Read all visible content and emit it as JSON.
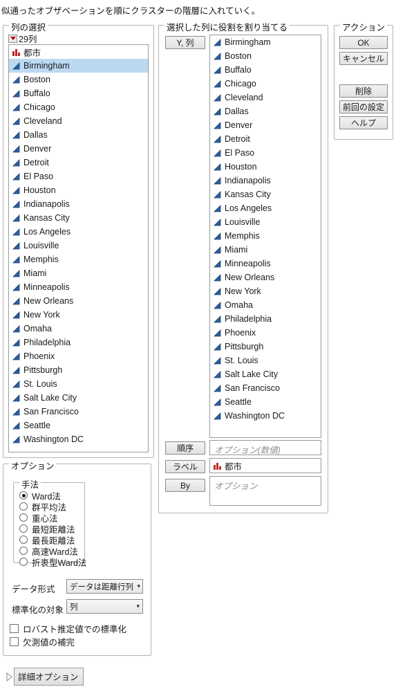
{
  "caption": "似通ったオブザベーションを順にクラスターの階層に入れていく。",
  "colors": {
    "selection": "#bcd9f2",
    "continuous_icon": "#2b5f9e",
    "nominal_icon": "#c0282d",
    "panel_border": "#b3b3b3"
  },
  "column_select": {
    "legend": "列の選択",
    "collapser_label": "29列",
    "collapser_icon": "triangle-down-icon",
    "items": [
      {
        "label": "都市",
        "icon": "nominal-bar-icon",
        "selected": false
      },
      {
        "label": "Birmingham",
        "icon": "continuous-triangle-icon",
        "selected": true
      },
      {
        "label": "Boston",
        "icon": "continuous-triangle-icon",
        "selected": false
      },
      {
        "label": "Buffalo",
        "icon": "continuous-triangle-icon",
        "selected": false
      },
      {
        "label": "Chicago",
        "icon": "continuous-triangle-icon",
        "selected": false
      },
      {
        "label": "Cleveland",
        "icon": "continuous-triangle-icon",
        "selected": false
      },
      {
        "label": "Dallas",
        "icon": "continuous-triangle-icon",
        "selected": false
      },
      {
        "label": "Denver",
        "icon": "continuous-triangle-icon",
        "selected": false
      },
      {
        "label": "Detroit",
        "icon": "continuous-triangle-icon",
        "selected": false
      },
      {
        "label": "El Paso",
        "icon": "continuous-triangle-icon",
        "selected": false
      },
      {
        "label": "Houston",
        "icon": "continuous-triangle-icon",
        "selected": false
      },
      {
        "label": "Indianapolis",
        "icon": "continuous-triangle-icon",
        "selected": false
      },
      {
        "label": "Kansas City",
        "icon": "continuous-triangle-icon",
        "selected": false
      },
      {
        "label": "Los Angeles",
        "icon": "continuous-triangle-icon",
        "selected": false
      },
      {
        "label": "Louisville",
        "icon": "continuous-triangle-icon",
        "selected": false
      },
      {
        "label": "Memphis",
        "icon": "continuous-triangle-icon",
        "selected": false
      },
      {
        "label": "Miami",
        "icon": "continuous-triangle-icon",
        "selected": false
      },
      {
        "label": "Minneapolis",
        "icon": "continuous-triangle-icon",
        "selected": false
      },
      {
        "label": "New Orleans",
        "icon": "continuous-triangle-icon",
        "selected": false
      },
      {
        "label": "New York",
        "icon": "continuous-triangle-icon",
        "selected": false
      },
      {
        "label": "Omaha",
        "icon": "continuous-triangle-icon",
        "selected": false
      },
      {
        "label": "Philadelphia",
        "icon": "continuous-triangle-icon",
        "selected": false
      },
      {
        "label": "Phoenix",
        "icon": "continuous-triangle-icon",
        "selected": false
      },
      {
        "label": "Pittsburgh",
        "icon": "continuous-triangle-icon",
        "selected": false
      },
      {
        "label": "St. Louis",
        "icon": "continuous-triangle-icon",
        "selected": false
      },
      {
        "label": "Salt Lake City",
        "icon": "continuous-triangle-icon",
        "selected": false
      },
      {
        "label": "San Francisco",
        "icon": "continuous-triangle-icon",
        "selected": false
      },
      {
        "label": "Seattle",
        "icon": "continuous-triangle-icon",
        "selected": false
      },
      {
        "label": "Washington DC",
        "icon": "continuous-triangle-icon",
        "selected": false
      }
    ]
  },
  "roles": {
    "legend": "選択した列に役割を割り当てる",
    "y_button": "Y, 列",
    "y_items": [
      {
        "label": "Birmingham",
        "icon": "continuous-triangle-icon"
      },
      {
        "label": "Boston",
        "icon": "continuous-triangle-icon"
      },
      {
        "label": "Buffalo",
        "icon": "continuous-triangle-icon"
      },
      {
        "label": "Chicago",
        "icon": "continuous-triangle-icon"
      },
      {
        "label": "Cleveland",
        "icon": "continuous-triangle-icon"
      },
      {
        "label": "Dallas",
        "icon": "continuous-triangle-icon"
      },
      {
        "label": "Denver",
        "icon": "continuous-triangle-icon"
      },
      {
        "label": "Detroit",
        "icon": "continuous-triangle-icon"
      },
      {
        "label": "El Paso",
        "icon": "continuous-triangle-icon"
      },
      {
        "label": "Houston",
        "icon": "continuous-triangle-icon"
      },
      {
        "label": "Indianapolis",
        "icon": "continuous-triangle-icon"
      },
      {
        "label": "Kansas City",
        "icon": "continuous-triangle-icon"
      },
      {
        "label": "Los Angeles",
        "icon": "continuous-triangle-icon"
      },
      {
        "label": "Louisville",
        "icon": "continuous-triangle-icon"
      },
      {
        "label": "Memphis",
        "icon": "continuous-triangle-icon"
      },
      {
        "label": "Miami",
        "icon": "continuous-triangle-icon"
      },
      {
        "label": "Minneapolis",
        "icon": "continuous-triangle-icon"
      },
      {
        "label": "New Orleans",
        "icon": "continuous-triangle-icon"
      },
      {
        "label": "New York",
        "icon": "continuous-triangle-icon"
      },
      {
        "label": "Omaha",
        "icon": "continuous-triangle-icon"
      },
      {
        "label": "Philadelphia",
        "icon": "continuous-triangle-icon"
      },
      {
        "label": "Phoenix",
        "icon": "continuous-triangle-icon"
      },
      {
        "label": "Pittsburgh",
        "icon": "continuous-triangle-icon"
      },
      {
        "label": "St. Louis",
        "icon": "continuous-triangle-icon"
      },
      {
        "label": "Salt Lake City",
        "icon": "continuous-triangle-icon"
      },
      {
        "label": "San Francisco",
        "icon": "continuous-triangle-icon"
      },
      {
        "label": "Seattle",
        "icon": "continuous-triangle-icon"
      },
      {
        "label": "Washington DC",
        "icon": "continuous-triangle-icon"
      }
    ],
    "order_button": "順序",
    "order_placeholder": "オプション(数値)",
    "label_button": "ラベル",
    "label_value": "都市",
    "label_value_icon": "nominal-bar-icon",
    "by_button": "By",
    "by_placeholder": "オプション"
  },
  "action": {
    "legend": "アクション",
    "ok": "OK",
    "cancel": "キャンセル",
    "remove": "削除",
    "recall": "前回の設定",
    "help": "ヘルプ"
  },
  "options": {
    "legend": "オプション",
    "method": {
      "legend": "手法",
      "items": [
        {
          "label": "Ward法",
          "selected": true
        },
        {
          "label": "群平均法",
          "selected": false
        },
        {
          "label": "重心法",
          "selected": false
        },
        {
          "label": "最短距離法",
          "selected": false
        },
        {
          "label": "最長距離法",
          "selected": false
        },
        {
          "label": "高速Ward法",
          "selected": false
        },
        {
          "label": "折衷型Ward法",
          "selected": false
        }
      ]
    },
    "data_format_label": "データ形式",
    "data_format_value": "データは距離行列",
    "standardize_label": "標準化の対象",
    "standardize_value": "列",
    "robust_checkbox": "ロバスト推定値での標準化",
    "robust_checked": false,
    "impute_checkbox": "欠測値の補完",
    "impute_checked": false
  },
  "footer": {
    "advanced_label": "詳細オプション",
    "advanced_icon": "triangle-right-icon"
  }
}
